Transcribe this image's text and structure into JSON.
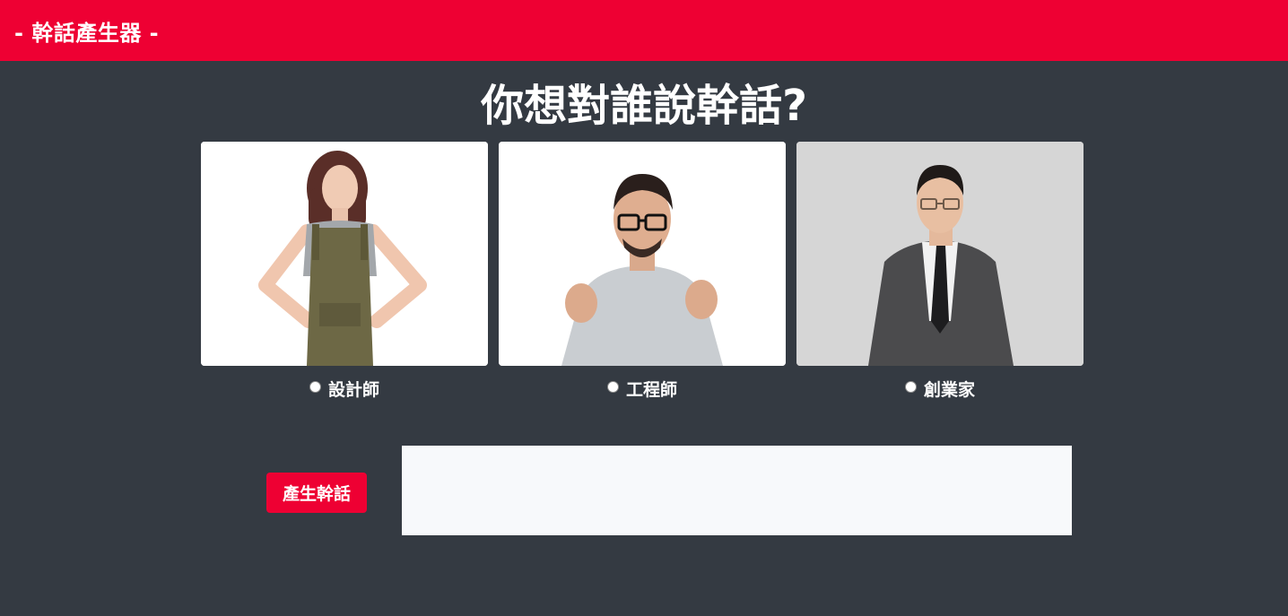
{
  "navbar": {
    "brand": "- 幹話產生器 -"
  },
  "main": {
    "title": "你想對誰說幹話?"
  },
  "options": [
    {
      "label": "設計師",
      "selected": false
    },
    {
      "label": "工程師",
      "selected": false
    },
    {
      "label": "創業家",
      "selected": false
    }
  ],
  "generator": {
    "button_label": "產生幹話",
    "output": ""
  },
  "colors": {
    "accent": "#ee0033",
    "background": "#343a42",
    "output_bg": "#f7f9fb"
  }
}
